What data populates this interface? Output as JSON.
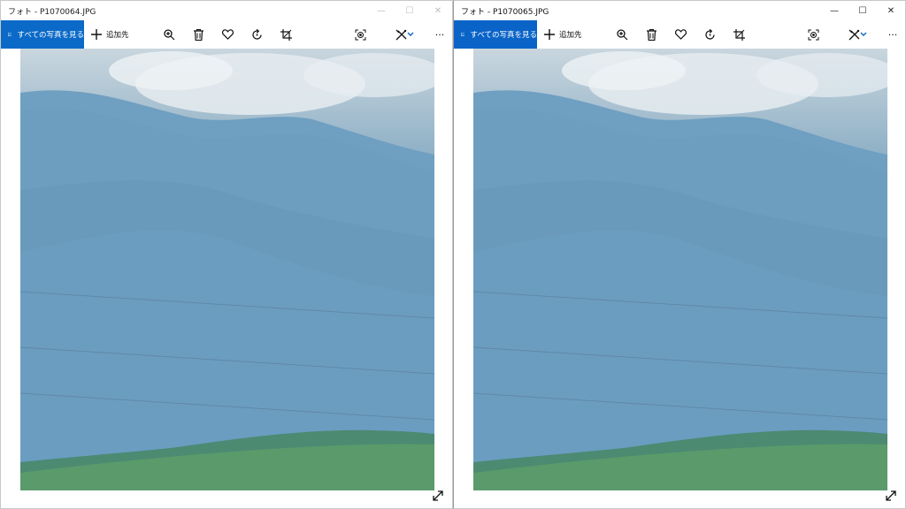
{
  "windows": [
    {
      "title": "フォト - P1070064.JPG",
      "all_photos_label": "すべての写真を見る",
      "add_to_label": "追加先"
    },
    {
      "title": "フォト - P1070065.JPG",
      "all_photos_label": "すべての写真を見る",
      "add_to_label": "追加先"
    }
  ],
  "caption_buttons": {
    "minimize": "—",
    "maximize": "☐",
    "close": "✕"
  },
  "toolbar_icons": [
    "zoom-icon",
    "delete-icon",
    "favorite-icon",
    "rotate-icon",
    "crop-icon",
    "spot-fix-icon",
    "edit-draw-icon",
    "more-icon"
  ],
  "more_label": "···",
  "colors": {
    "accent": "#0a64c8",
    "title_text": "#111111"
  }
}
